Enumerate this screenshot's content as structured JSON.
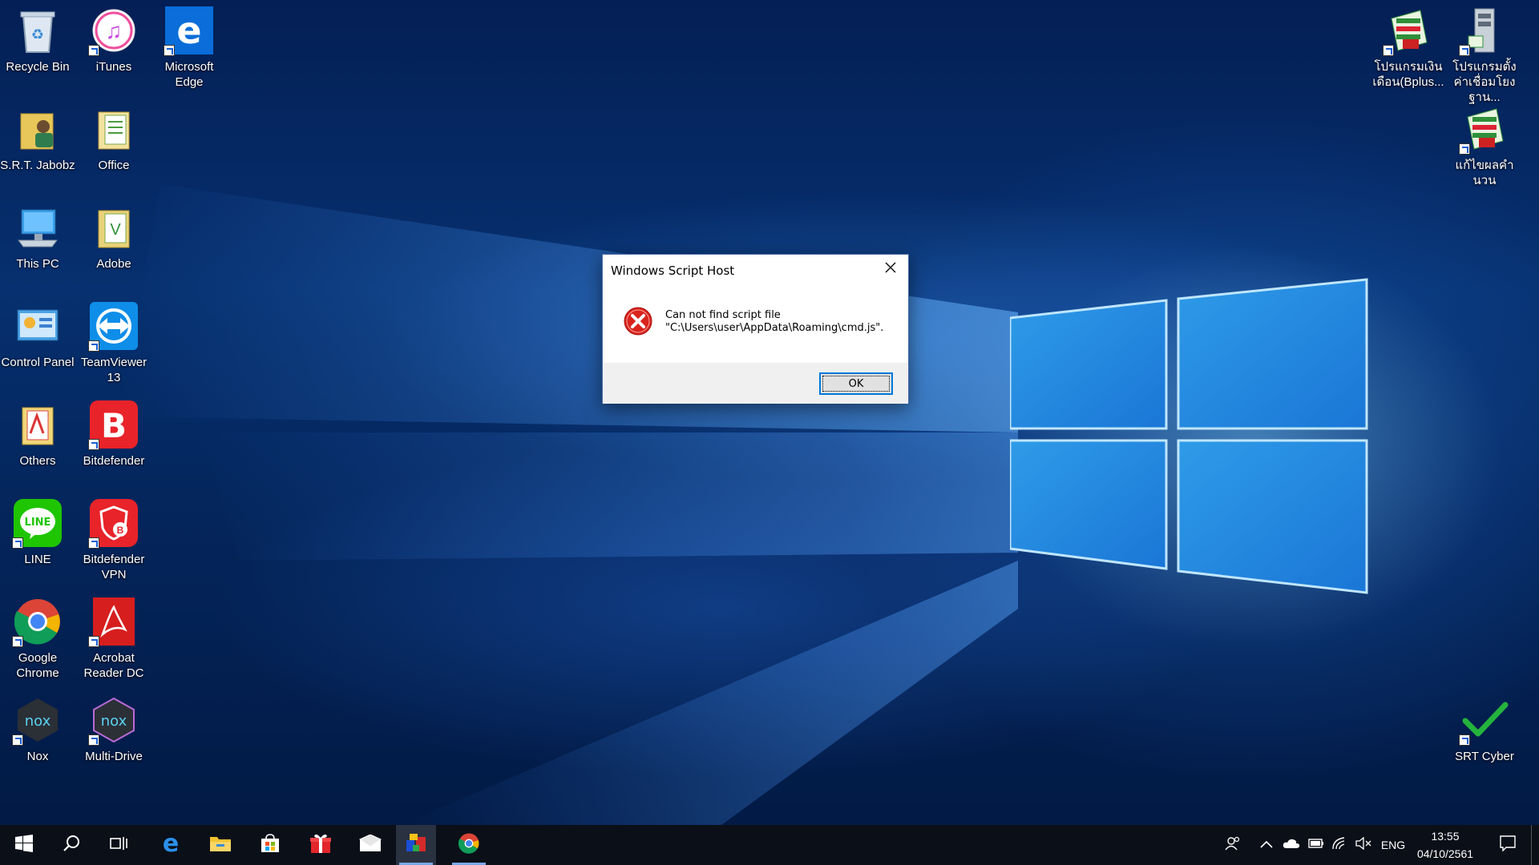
{
  "desktop_icons_left": [
    {
      "label": "Recycle Bin",
      "icon": "recycle-bin-icon"
    },
    {
      "label": "iTunes",
      "icon": "itunes-icon"
    },
    {
      "label": "Microsoft Edge",
      "icon": "edge-icon"
    },
    {
      "label": "S.R.T. Jabobz",
      "icon": "user-folder-icon"
    },
    {
      "label": "Office",
      "icon": "office-folder-icon"
    },
    {
      "label": "This PC",
      "icon": "computer-icon"
    },
    {
      "label": "Adobe",
      "icon": "adobe-folder-icon"
    },
    {
      "label": "Control Panel",
      "icon": "control-panel-icon"
    },
    {
      "label": "TeamViewer 13",
      "icon": "teamviewer-icon"
    },
    {
      "label": "Others",
      "icon": "others-folder-icon"
    },
    {
      "label": "Bitdefender",
      "icon": "bitdefender-icon"
    },
    {
      "label": "LINE",
      "icon": "line-icon"
    },
    {
      "label": "Bitdefender VPN",
      "icon": "bitdefender-vpn-icon"
    },
    {
      "label": "Google Chrome",
      "icon": "chrome-icon"
    },
    {
      "label": "Acrobat Reader DC",
      "icon": "acrobat-icon"
    },
    {
      "label": "Nox",
      "icon": "nox-icon"
    },
    {
      "label": "Multi-Drive",
      "icon": "nox-multidrive-icon"
    }
  ],
  "desktop_icons_right": [
    {
      "label": "โปรแกรมเงินเดือน(Bplus...",
      "icon": "payroll-program-icon"
    },
    {
      "label": "โปรแกรมตั้งค่าเชื่อมโยงฐาน...",
      "icon": "settings-program-icon"
    },
    {
      "label": "แก้ไขผลคำนวน",
      "icon": "calc-program-icon"
    },
    {
      "label": "SRT Cyber",
      "icon": "checkmark-icon"
    }
  ],
  "dialog": {
    "title": "Windows Script Host",
    "message_line1": "Can not find script file",
    "message_line2": "\"C:\\Users\\user\\AppData\\Roaming\\cmd.js\".",
    "ok_label": "OK",
    "icon": "error-icon"
  },
  "taskbar": {
    "pinned": [
      "start-icon",
      "search-icon",
      "task-view-icon",
      "edge-icon",
      "file-explorer-icon",
      "store-icon",
      "gift-icon",
      "mail-icon",
      "program-icon",
      "chrome-icon"
    ],
    "language": "ENG",
    "time": "13:55",
    "date": "04/10/2561"
  },
  "colors": {
    "accent": "#0078d7",
    "taskbar": "#0a0f18",
    "error_red": "#d9241c"
  }
}
